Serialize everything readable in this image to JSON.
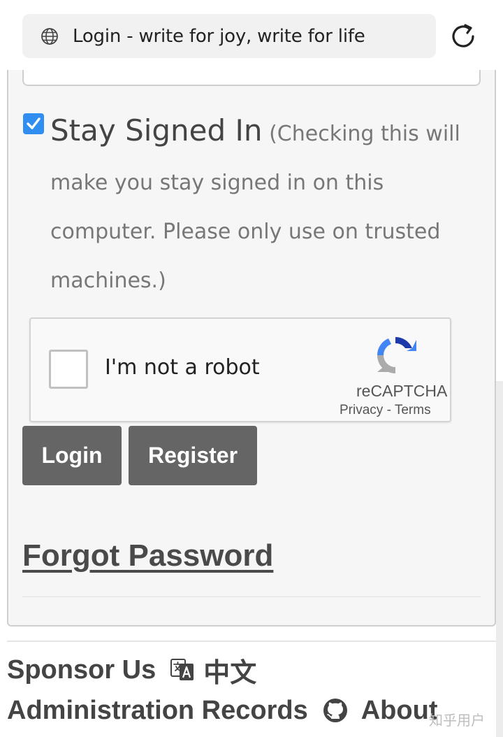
{
  "browser": {
    "page_title": "Login - write for joy, write for life"
  },
  "form": {
    "stay_signed_in": {
      "checked": true,
      "label": "Stay Signed In",
      "note": "(Checking this will make you stay signed in on this computer. Please only use on trusted machines.)"
    },
    "recaptcha": {
      "label": "I'm not a robot",
      "brand": "reCAPTCHA",
      "privacy": "Privacy",
      "separator": " - ",
      "terms": "Terms"
    },
    "login_button": "Login",
    "register_button": "Register",
    "forgot_password": "Forgot Password"
  },
  "footer": {
    "sponsor": "Sponsor Us",
    "language": "中文",
    "admin_records": "Administration Records",
    "about": "About"
  },
  "watermark": "知乎用户",
  "icons": {
    "address_bar": "globe-icon",
    "reload": "reload-icon",
    "language": "translate-icon",
    "about": "github-icon"
  },
  "colors": {
    "checkbox_accent": "#2f8ef0",
    "button_bg": "#656565",
    "card_bg": "#f6f6f6"
  }
}
